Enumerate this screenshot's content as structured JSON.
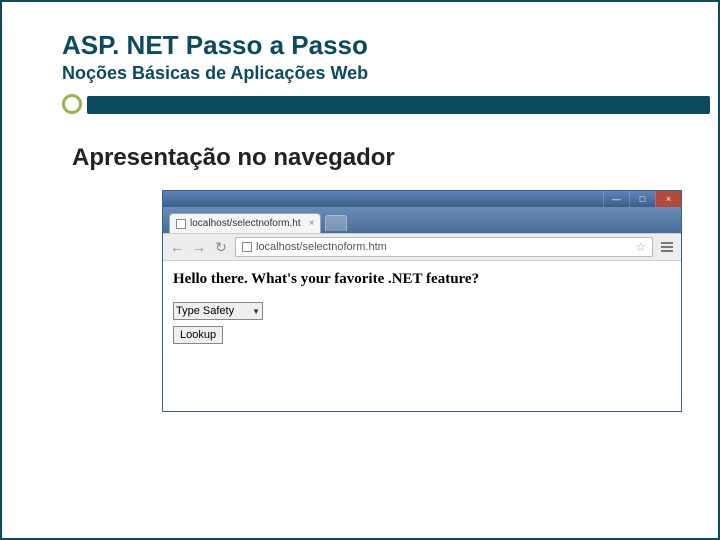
{
  "slide": {
    "title": "ASP. NET Passo a Passo",
    "subtitle": "Noções Básicas de Aplicações Web",
    "section_heading": "Apresentação no navegador"
  },
  "browser": {
    "window_controls": {
      "minimize": "—",
      "maximize": "□",
      "close": "×"
    },
    "tab": {
      "label": "localhost/selectnoform.ht",
      "close": "×"
    },
    "nav": {
      "back": "←",
      "forward": "→",
      "reload": "↻"
    },
    "address_bar": {
      "url": "localhost/selectnoform.htm",
      "star": "☆"
    },
    "page": {
      "heading": "Hello there. What's your favorite .NET feature?",
      "dropdown_value": "Type Safety",
      "button_label": "Lookup"
    }
  }
}
